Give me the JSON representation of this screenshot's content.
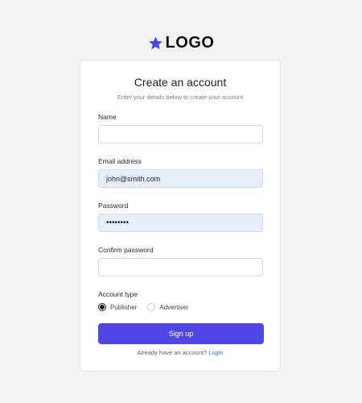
{
  "brand": {
    "name": "LOGO",
    "icon": "star-icon",
    "icon_color": "#4f46e5"
  },
  "form": {
    "title": "Create an account",
    "subtitle": "Enter your details below to create your account",
    "name": {
      "label": "Name",
      "value": ""
    },
    "email": {
      "label": "Email address",
      "value": "john@smith.com"
    },
    "password": {
      "label": "Password",
      "value": "••••••••"
    },
    "confirm_password": {
      "label": "Confirm password",
      "value": ""
    },
    "account_type": {
      "label": "Account type",
      "options": [
        "Publisher",
        "Advertiser"
      ],
      "selected": "Publisher"
    },
    "submit_label": "Sign up",
    "footer_text": "Already have an account?",
    "login_link": "Login"
  },
  "colors": {
    "accent": "#4f46e5",
    "autofill": "#e8effb",
    "background": "#f3f3f4"
  }
}
